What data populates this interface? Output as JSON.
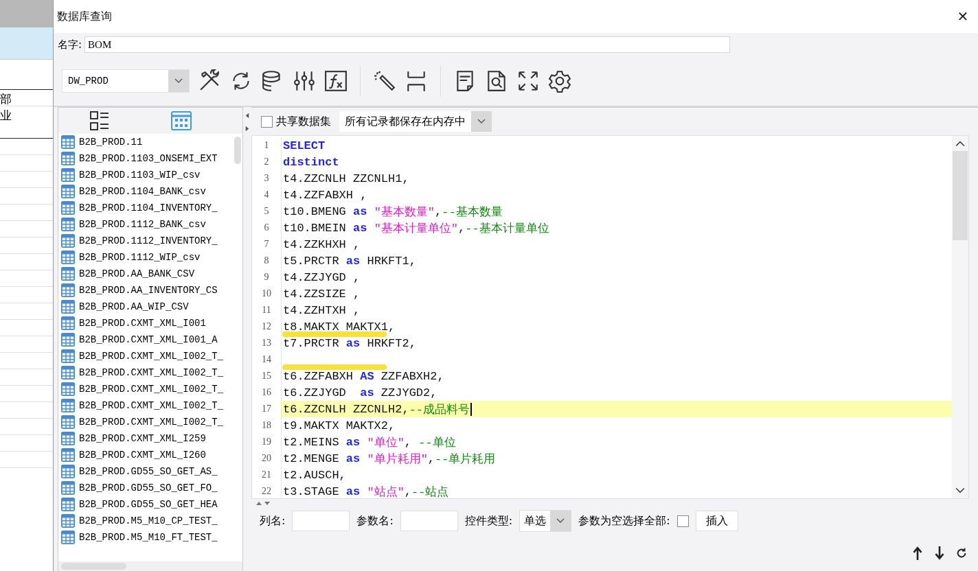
{
  "background_sheet": {
    "cells": [
      "部",
      "业"
    ]
  },
  "window": {
    "title": "数据库查询",
    "close": "✕"
  },
  "name_field": {
    "label": "名字:",
    "value": "BOM"
  },
  "toolbar": {
    "datasource": "DW_PROD"
  },
  "left_panel": {
    "tables": [
      "B2B_PROD.11",
      "B2B_PROD.1103_ONSEMI_EXT",
      "B2B_PROD.1103_WIP_csv",
      "B2B_PROD.1104_BANK_csv",
      "B2B_PROD.1104_INVENTORY_",
      "B2B_PROD.1112_BANK_csv",
      "B2B_PROD.1112_INVENTORY_",
      "B2B_PROD.1112_WIP_csv",
      "B2B_PROD.AA_BANK_CSV",
      "B2B_PROD.AA_INVENTORY_CS",
      "B2B_PROD.AA_WIP_CSV",
      "B2B_PROD.CXMT_XML_I001",
      "B2B_PROD.CXMT_XML_I001_A",
      "B2B_PROD.CXMT_XML_I002_T_",
      "B2B_PROD.CXMT_XML_I002_T_",
      "B2B_PROD.CXMT_XML_I002_T_",
      "B2B_PROD.CXMT_XML_I002_T_",
      "B2B_PROD.CXMT_XML_I002_T_",
      "B2B_PROD.CXMT_XML_I259",
      "B2B_PROD.CXMT_XML_I260",
      "B2B_PROD.GD55_SO_GET_AS_",
      "B2B_PROD.GD55_SO_GET_FO_",
      "B2B_PROD.GD55_SO_GET_HEA",
      "B2B_PROD.M5_M10_CP_TEST_",
      "B2B_PROD.M5_M10_FT_TEST_"
    ]
  },
  "options": {
    "shared_dataset": {
      "label": "共享数据集",
      "checked": false
    },
    "storage_mode": "所有记录都保存在内存中"
  },
  "editor": {
    "lines": [
      {
        "number": "1",
        "current": false,
        "marked": false,
        "tokens": [
          {
            "kind": "keyword",
            "text": "SELECT"
          }
        ]
      },
      {
        "number": "2",
        "current": false,
        "marked": false,
        "tokens": [
          {
            "kind": "keyword",
            "text": "distinct"
          }
        ]
      },
      {
        "number": "3",
        "current": false,
        "marked": false,
        "tokens": [
          {
            "kind": "plain",
            "text": "t4.ZZCNLH ZZCNLH1,"
          }
        ]
      },
      {
        "number": "4",
        "current": false,
        "marked": false,
        "tokens": [
          {
            "kind": "plain",
            "text": "t4.ZZFABXH ,"
          }
        ]
      },
      {
        "number": "5",
        "current": false,
        "marked": false,
        "tokens": [
          {
            "kind": "plain",
            "text": "t10.BMENG "
          },
          {
            "kind": "keyword",
            "text": "as"
          },
          {
            "kind": "string",
            "text": " \"基本数量\""
          },
          {
            "kind": "plain",
            "text": ","
          },
          {
            "kind": "comment",
            "text": "--基本数量"
          }
        ]
      },
      {
        "number": "6",
        "current": false,
        "marked": false,
        "tokens": [
          {
            "kind": "plain",
            "text": "t10.BMEIN "
          },
          {
            "kind": "keyword",
            "text": "as"
          },
          {
            "kind": "string",
            "text": " \"基本计量单位\""
          },
          {
            "kind": "plain",
            "text": ","
          },
          {
            "kind": "comment",
            "text": "--基本计量单位"
          }
        ]
      },
      {
        "number": "7",
        "current": false,
        "marked": false,
        "tokens": [
          {
            "kind": "plain",
            "text": "t4.ZZKHXH ,"
          }
        ]
      },
      {
        "number": "8",
        "current": false,
        "marked": false,
        "tokens": [
          {
            "kind": "plain",
            "text": "t5.PRCTR "
          },
          {
            "kind": "keyword",
            "text": "as"
          },
          {
            "kind": "plain",
            "text": " HRKFT1,"
          }
        ]
      },
      {
        "number": "9",
        "current": false,
        "marked": false,
        "tokens": [
          {
            "kind": "plain",
            "text": "t4.ZZJYGD ,"
          }
        ]
      },
      {
        "number": "10",
        "current": false,
        "marked": false,
        "tokens": [
          {
            "kind": "plain",
            "text": "t4.ZZSIZE ,"
          }
        ]
      },
      {
        "number": "11",
        "current": false,
        "marked": false,
        "tokens": [
          {
            "kind": "plain",
            "text": "t4.ZZHTXH ,"
          }
        ]
      },
      {
        "number": "12",
        "current": false,
        "marked": true,
        "tokens": [
          {
            "kind": "plain",
            "text": "t8.MAKTX MAKTX1,"
          }
        ]
      },
      {
        "number": "13",
        "current": false,
        "marked": false,
        "tokens": [
          {
            "kind": "plain",
            "text": "t7.PRCTR "
          },
          {
            "kind": "keyword",
            "text": "as"
          },
          {
            "kind": "plain",
            "text": " HRKFT2,"
          }
        ]
      },
      {
        "number": "14",
        "current": false,
        "marked": true
      },
      {
        "number": "15",
        "current": false,
        "marked": false,
        "tokens": [
          {
            "kind": "plain",
            "text": "t6.ZZFABXH "
          },
          {
            "kind": "keyword",
            "text": "AS"
          },
          {
            "kind": "plain",
            "text": " ZZFABXH2,"
          }
        ]
      },
      {
        "number": "16",
        "current": false,
        "marked": false,
        "tokens": [
          {
            "kind": "plain",
            "text": "t6.ZZJYGD  "
          },
          {
            "kind": "keyword",
            "text": "as"
          },
          {
            "kind": "plain",
            "text": " ZZJYGD2,"
          }
        ]
      },
      {
        "number": "17",
        "current": true,
        "marked": false,
        "tokens": [
          {
            "kind": "plain",
            "text": "t6.ZZCNLH ZZCNLH2,"
          },
          {
            "kind": "comment",
            "text": "--成品料号"
          }
        ]
      },
      {
        "number": "18",
        "current": false,
        "marked": false,
        "tokens": [
          {
            "kind": "plain",
            "text": "t9.MAKTX MAKTX2,"
          }
        ]
      },
      {
        "number": "19",
        "current": false,
        "marked": false,
        "tokens": [
          {
            "kind": "plain",
            "text": "t2.MEINS "
          },
          {
            "kind": "keyword",
            "text": "as"
          },
          {
            "kind": "string",
            "text": " \"单位\""
          },
          {
            "kind": "plain",
            "text": ", "
          },
          {
            "kind": "comment",
            "text": "--单位"
          }
        ]
      },
      {
        "number": "20",
        "current": false,
        "marked": false,
        "tokens": [
          {
            "kind": "plain",
            "text": "t2.MENGE "
          },
          {
            "kind": "keyword",
            "text": "as"
          },
          {
            "kind": "string",
            "text": " \"单片耗用\""
          },
          {
            "kind": "plain",
            "text": ","
          },
          {
            "kind": "comment",
            "text": "--单片耗用"
          }
        ]
      },
      {
        "number": "21",
        "current": false,
        "marked": false,
        "tokens": [
          {
            "kind": "plain",
            "text": "t2.AUSCH,"
          }
        ]
      },
      {
        "number": "22",
        "current": false,
        "marked": false,
        "tokens": [
          {
            "kind": "plain",
            "text": "t3.STAGE "
          },
          {
            "kind": "keyword",
            "text": "as"
          },
          {
            "kind": "string",
            "text": " \"站点\""
          },
          {
            "kind": "plain",
            "text": ","
          },
          {
            "kind": "comment",
            "text": "--站点"
          }
        ]
      }
    ]
  },
  "parameters": {
    "column_label": "列名:",
    "param_label": "参数名:",
    "control_label": "控件类型:",
    "control_value": "单选",
    "empty_all_label": "参数为空选择全部:",
    "empty_all_checked": false,
    "insert_button": "插入"
  }
}
